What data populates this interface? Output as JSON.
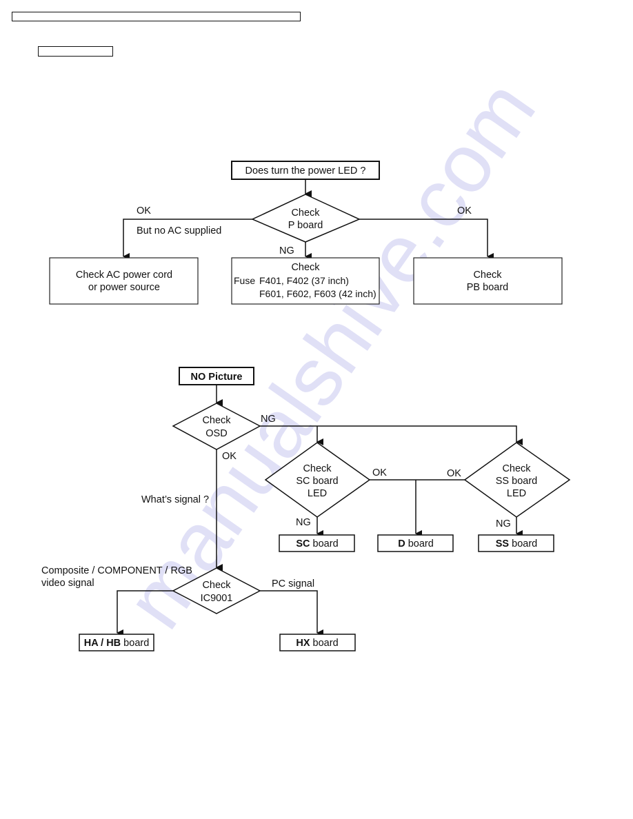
{
  "header": {
    "title_box": "",
    "section_box": ""
  },
  "watermark": "manualshive.com",
  "flow_power": {
    "start": "Does turn the power LED ?",
    "decision": [
      "Check",
      "P board"
    ],
    "left_branch_label": "OK",
    "left_branch_note": "But no AC supplied",
    "left_result": [
      "Check AC power cord",
      "or power source"
    ],
    "down_branch_label": "NG",
    "down_result": {
      "title": "Check",
      "line1_prefix": "Fuse",
      "line1": "F401, F402  (37 inch)",
      "line2": "F601, F602, F603  (42 inch)"
    },
    "right_branch_label": "OK",
    "right_result": [
      "Check",
      "PB board"
    ]
  },
  "flow_picture": {
    "start": "NO Picture",
    "osd_decision": [
      "Check",
      "OSD"
    ],
    "osd_ng_label": "NG",
    "osd_ok_label": "OK",
    "signal_question": "What’s signal ?",
    "sc_decision": [
      "Check",
      "SC board",
      "LED"
    ],
    "ss_decision": [
      "Check",
      "SS board",
      "LED"
    ],
    "sc_ok_label": "OK",
    "ss_ok_label": "OK",
    "sc_ng_label": "NG",
    "ss_ng_label": "NG",
    "sc_result": {
      "bold": "SC",
      "rest": " board"
    },
    "d_result": {
      "bold": "D",
      "rest": " board"
    },
    "ss_result": {
      "bold": "SS",
      "rest": " board"
    },
    "ic_decision": [
      "Check",
      "IC9001"
    ],
    "video_label": [
      "Composite / COMPONENT / RGB",
      "video signal"
    ],
    "pc_label": "PC signal",
    "ha_result": {
      "bold": "HA / HB",
      "rest": " board"
    },
    "hx_result": {
      "bold": "HX",
      "rest": " board"
    }
  }
}
